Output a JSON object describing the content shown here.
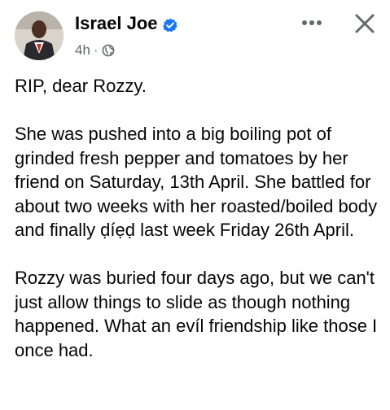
{
  "post": {
    "author": "Israel Joe",
    "time": "4h",
    "separator": "·",
    "icons": {
      "verified": "verified-badge-icon",
      "audience": "globe-icon",
      "more": "more-options-icon",
      "close": "close-icon"
    },
    "colors": {
      "verified_blue": "#1877f2",
      "meta_gray": "#65676b",
      "text": "#050505"
    },
    "paragraphs": [
      "RIP, dear Rozzy.",
      "She was pushed into a big boiling pot of grinded fresh pepper and tomatoes by her friend on Saturday, 13th April. She battled for about two weeks with her roasted/boiled body and finally ḍíẹḍ last week Friday 26th April.",
      "Rozzy was buried four days ago, but we can't just allow things to slide as though nothing happened. What an evíl friendship like those I once had."
    ]
  }
}
